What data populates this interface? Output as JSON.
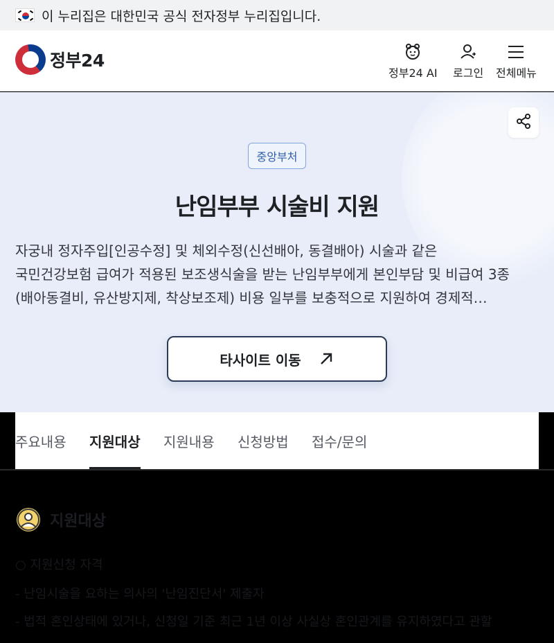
{
  "gov_banner": {
    "text": "이 누리집은 대한민국 공식 전자정부 누리집입니다."
  },
  "header": {
    "logo_text": "정부24",
    "ai_label": "정부24 AI",
    "login_label": "로그인",
    "menu_label": "전체메뉴"
  },
  "hero": {
    "badge": "중앙부처",
    "title": "난임부부 시술비 지원",
    "description_lines": [
      "자궁내 정자주입[인공수정] 및 체외수정(신선배아, 동결배아) 시술과 같은",
      "국민건강보험 급여가 적용된 보조생식술을 받는 난임부부에게 본인부담 및 비급여 3종",
      "(배아동결비, 유산방지제, 착상보조제) 비용 일부를 보충적으로 지원하여 경제적…"
    ],
    "cta_label": "타사이트 이동"
  },
  "tabs": [
    {
      "label": "주요내용",
      "active": false
    },
    {
      "label": "지원대상",
      "active": true
    },
    {
      "label": "지원내용",
      "active": false
    },
    {
      "label": "신청방법",
      "active": false
    },
    {
      "label": "접수/문의",
      "active": false
    }
  ],
  "section": {
    "title": "지원대상",
    "lines": [
      "○ 지원신청 자격",
      "- 난임시술을 요하는 의사의 '난임진단서' 제출자",
      "- 법적 혼인상태에 있거나, 신청일 기준 최근 1년 이상 사실상 혼인관계를 유지하였다고 관할"
    ]
  },
  "colors": {
    "hero_bg": "#e8edf9",
    "badge_text": "#2d5fa8",
    "cta_border": "#2b3a57"
  },
  "icons": [
    "flag-icon",
    "gov24-logo",
    "ai-mascot-icon",
    "user-icon",
    "hamburger-icon",
    "share-icon",
    "arrow-up-right-icon",
    "person-icon"
  ]
}
